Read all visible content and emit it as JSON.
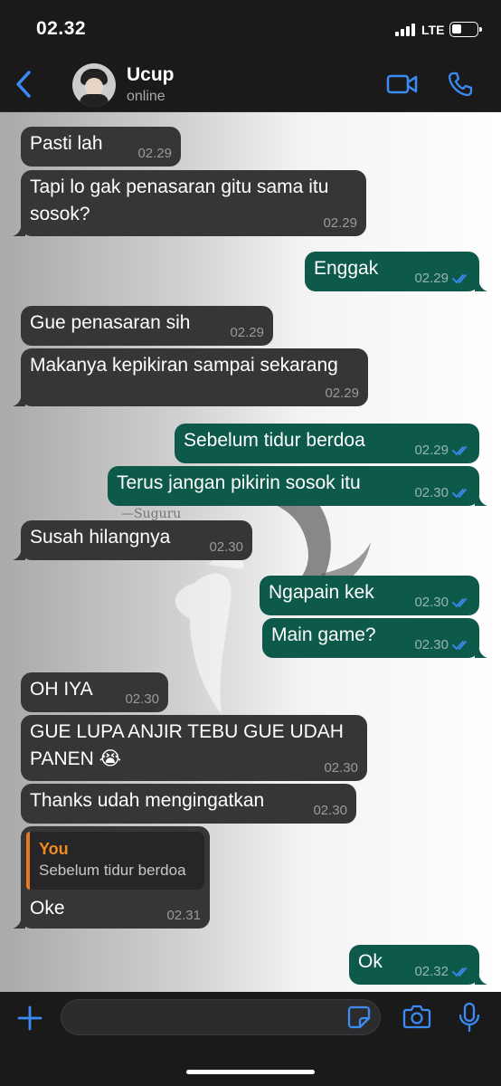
{
  "status_bar": {
    "time": "02.32",
    "network": "LTE"
  },
  "header": {
    "contact_name": "Ucup",
    "contact_status": "online"
  },
  "wallpaper_text": "—Suguru",
  "messages": [
    {
      "dir": "in",
      "text": "Pasti lah",
      "time": "02.29"
    },
    {
      "dir": "in",
      "text": "Tapi lo gak penasaran gitu sama itu\nsosok?",
      "time": "02.29"
    },
    {
      "dir": "out",
      "text": "Enggak",
      "time": "02.29"
    },
    {
      "dir": "in",
      "text": "Gue penasaran sih",
      "time": "02.29"
    },
    {
      "dir": "in",
      "text": "Makanya kepikiran sampai sekarang",
      "time": "02.29"
    },
    {
      "dir": "out",
      "text": "Sebelum tidur berdoa",
      "time": "02.29"
    },
    {
      "dir": "out",
      "text": "Terus jangan pikirin sosok itu",
      "time": "02.30"
    },
    {
      "dir": "in",
      "text": "Susah hilangnya",
      "time": "02.30"
    },
    {
      "dir": "out",
      "text": "Ngapain kek",
      "time": "02.30"
    },
    {
      "dir": "out",
      "text": "Main game?",
      "time": "02.30"
    },
    {
      "dir": "in",
      "text": "OH IYA",
      "time": "02.30"
    },
    {
      "dir": "in",
      "text": "GUE LUPA ANJIR TEBU GUE UDAH\nPANEN 😭",
      "time": "02.30"
    },
    {
      "dir": "in",
      "text": "Thanks udah mengingatkan",
      "time": "02.30"
    },
    {
      "dir": "in",
      "text": "Oke",
      "time": "02.31",
      "reply": {
        "author": "You",
        "text": "Sebelum tidur berdoa"
      }
    },
    {
      "dir": "out",
      "text": "Ok",
      "time": "02.32"
    }
  ],
  "input": {
    "value": "",
    "placeholder": ""
  },
  "colors": {
    "accent": "#3b8bf5",
    "outgoing": "#0d5a4a",
    "incoming": "#363638",
    "reply_author": "#f28a22"
  }
}
